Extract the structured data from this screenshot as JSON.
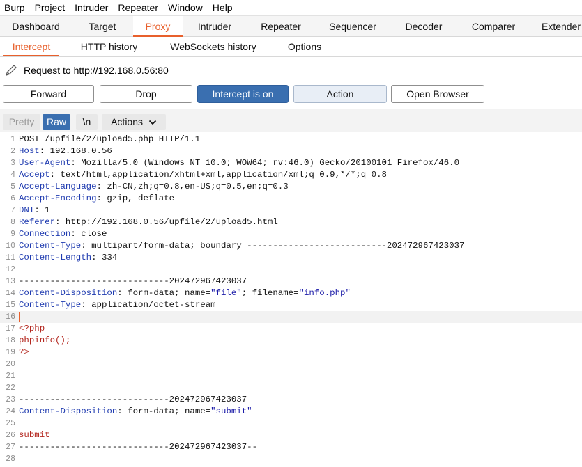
{
  "menubar": [
    "Burp",
    "Project",
    "Intruder",
    "Repeater",
    "Window",
    "Help"
  ],
  "main_tabs": [
    "Dashboard",
    "Target",
    "Proxy",
    "Intruder",
    "Repeater",
    "Sequencer",
    "Decoder",
    "Comparer",
    "Extender"
  ],
  "active_main_tab": "Proxy",
  "sub_tabs": [
    "Intercept",
    "HTTP history",
    "WebSockets history",
    "Options"
  ],
  "active_sub_tab": "Intercept",
  "request_label": "Request to http://192.168.0.56:80",
  "buttons": {
    "forward": "Forward",
    "drop": "Drop",
    "intercept": "Intercept is on",
    "action": "Action",
    "open_browser": "Open Browser"
  },
  "toolbar": {
    "pretty": "Pretty",
    "raw": "Raw",
    "newline": "\\n",
    "actions": "Actions"
  },
  "colors": {
    "accent": "#e8602c",
    "primary_button": "#3a6fb0",
    "header_key": "#1f3bb0",
    "php_red": "#b3261e"
  },
  "lines": [
    {
      "n": "1",
      "parts": [
        {
          "t": "v",
          "text": "POST /upfile/2/upload5.php HTTP/1.1"
        }
      ]
    },
    {
      "n": "2",
      "parts": [
        {
          "t": "k",
          "text": "Host"
        },
        {
          "t": "v",
          "text": ": 192.168.0.56"
        }
      ]
    },
    {
      "n": "3",
      "parts": [
        {
          "t": "k",
          "text": "User-Agent"
        },
        {
          "t": "v",
          "text": ": Mozilla/5.0 (Windows NT 10.0; WOW64; rv:46.0) Gecko/20100101 Firefox/46.0"
        }
      ]
    },
    {
      "n": "4",
      "parts": [
        {
          "t": "k",
          "text": "Accept"
        },
        {
          "t": "v",
          "text": ": text/html,application/xhtml+xml,application/xml;q=0.9,*/*;q=0.8"
        }
      ]
    },
    {
      "n": "5",
      "parts": [
        {
          "t": "k",
          "text": "Accept-Language"
        },
        {
          "t": "v",
          "text": ": zh-CN,zh;q=0.8,en-US;q=0.5,en;q=0.3"
        }
      ]
    },
    {
      "n": "6",
      "parts": [
        {
          "t": "k",
          "text": "Accept-Encoding"
        },
        {
          "t": "v",
          "text": ": gzip, deflate"
        }
      ]
    },
    {
      "n": "7",
      "parts": [
        {
          "t": "k",
          "text": "DNT"
        },
        {
          "t": "v",
          "text": ": 1"
        }
      ]
    },
    {
      "n": "8",
      "parts": [
        {
          "t": "k",
          "text": "Referer"
        },
        {
          "t": "v",
          "text": ": http://192.168.0.56/upfile/2/upload5.html"
        }
      ]
    },
    {
      "n": "9",
      "parts": [
        {
          "t": "k",
          "text": "Connection"
        },
        {
          "t": "v",
          "text": ": close"
        }
      ]
    },
    {
      "n": "10",
      "parts": [
        {
          "t": "k",
          "text": "Content-Type"
        },
        {
          "t": "v",
          "text": ": multipart/form-data; boundary=---------------------------202472967423037"
        }
      ]
    },
    {
      "n": "11",
      "parts": [
        {
          "t": "k",
          "text": "Content-Length"
        },
        {
          "t": "v",
          "text": ": 334"
        }
      ]
    },
    {
      "n": "12",
      "parts": []
    },
    {
      "n": "13",
      "parts": [
        {
          "t": "v",
          "text": "-----------------------------202472967423037"
        }
      ]
    },
    {
      "n": "14",
      "parts": [
        {
          "t": "k",
          "text": "Content-Disposition"
        },
        {
          "t": "v",
          "text": ": form-data; name="
        },
        {
          "t": "s",
          "text": "\"file\""
        },
        {
          "t": "v",
          "text": "; filename="
        },
        {
          "t": "s",
          "text": "\"info.php\""
        }
      ]
    },
    {
      "n": "15",
      "parts": [
        {
          "t": "k",
          "text": "Content-Type"
        },
        {
          "t": "v",
          "text": ": application/octet-stream"
        }
      ]
    },
    {
      "n": "16",
      "parts": [],
      "caret": true
    },
    {
      "n": "17",
      "parts": [
        {
          "t": "r",
          "text": "<?php"
        }
      ]
    },
    {
      "n": "18",
      "parts": [
        {
          "t": "r",
          "text": "phpinfo();"
        }
      ]
    },
    {
      "n": "19",
      "parts": [
        {
          "t": "r",
          "text": "?>"
        }
      ]
    },
    {
      "n": "20",
      "parts": []
    },
    {
      "n": "21",
      "parts": []
    },
    {
      "n": "22",
      "parts": []
    },
    {
      "n": "23",
      "parts": [
        {
          "t": "v",
          "text": "-----------------------------202472967423037"
        }
      ]
    },
    {
      "n": "24",
      "parts": [
        {
          "t": "k",
          "text": "Content-Disposition"
        },
        {
          "t": "v",
          "text": ": form-data; name="
        },
        {
          "t": "s",
          "text": "\"submit\""
        }
      ]
    },
    {
      "n": "25",
      "parts": []
    },
    {
      "n": "26",
      "parts": [
        {
          "t": "r",
          "text": "submit"
        }
      ]
    },
    {
      "n": "27",
      "parts": [
        {
          "t": "v",
          "text": "-----------------------------202472967423037--"
        }
      ]
    },
    {
      "n": "28",
      "parts": []
    }
  ]
}
